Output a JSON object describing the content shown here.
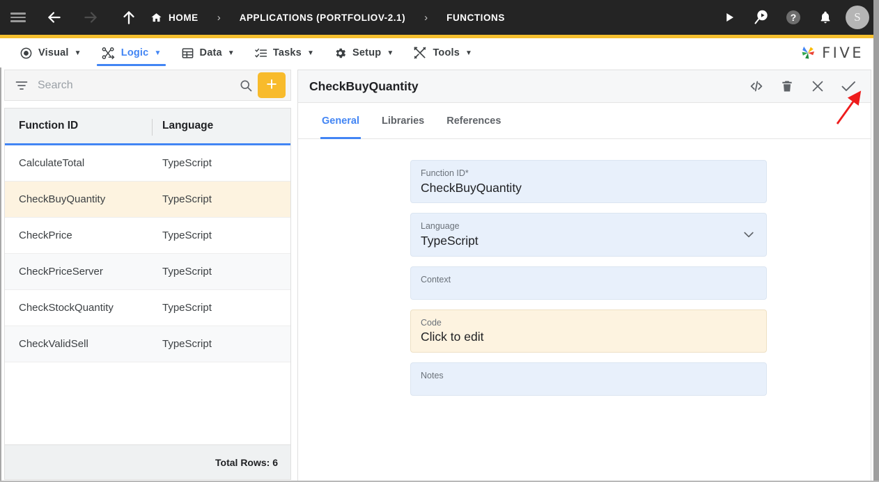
{
  "topbar": {
    "menu_icon": "hamburger-icon",
    "back_icon": "arrow-back-icon",
    "forward_icon": "arrow-forward-icon",
    "up_icon": "arrow-up-icon",
    "breadcrumbs": [
      {
        "label": "HOME",
        "icon": "home-icon"
      },
      {
        "label": "APPLICATIONS (PORTFOLIOV-2.1)",
        "icon": ""
      },
      {
        "label": "FUNCTIONS",
        "icon": ""
      }
    ],
    "separator": "›",
    "actions": [
      {
        "name": "run-button",
        "icon": "play-icon"
      },
      {
        "name": "search-run-button",
        "icon": "search-play-icon"
      },
      {
        "name": "help-button",
        "icon": "help-circle-icon"
      },
      {
        "name": "notifications-button",
        "icon": "bell-icon"
      }
    ],
    "avatar_initial": "S",
    "accent_color": "#f5bf2e",
    "background_color": "#242424"
  },
  "menubar": {
    "items": [
      {
        "label": "Visual",
        "icon": "eye-icon",
        "active": false
      },
      {
        "label": "Logic",
        "icon": "logic-network-icon",
        "active": true
      },
      {
        "label": "Data",
        "icon": "table-icon",
        "active": false
      },
      {
        "label": "Tasks",
        "icon": "checklist-icon",
        "active": false
      },
      {
        "label": "Setup",
        "icon": "gear-icon",
        "active": false
      },
      {
        "label": "Tools",
        "icon": "tools-icon",
        "active": false
      }
    ],
    "caret": "▼",
    "brand": "FIVE",
    "active_color": "#4285f4"
  },
  "sidebar": {
    "search": {
      "placeholder": "Search",
      "value": ""
    },
    "filter_icon": "filter-icon",
    "search_icon": "search-icon",
    "add_label": "+",
    "add_color": "#f8bb2c",
    "grid": {
      "columns": [
        "Function ID",
        "Language"
      ],
      "rows": [
        {
          "function_id": "CalculateTotal",
          "language": "TypeScript"
        },
        {
          "function_id": "CheckBuyQuantity",
          "language": "TypeScript"
        },
        {
          "function_id": "CheckPrice",
          "language": "TypeScript"
        },
        {
          "function_id": "CheckPriceServer",
          "language": "TypeScript"
        },
        {
          "function_id": "CheckStockQuantity",
          "language": "TypeScript"
        },
        {
          "function_id": "CheckValidSell",
          "language": "TypeScript"
        }
      ],
      "selected_index": 1,
      "footer": "Total Rows: 6",
      "selected_color": "#fdf3e0"
    }
  },
  "detail": {
    "title": "CheckBuyQuantity",
    "actions": [
      {
        "name": "view-code-button",
        "icon": "code-icon"
      },
      {
        "name": "delete-button",
        "icon": "trash-icon"
      },
      {
        "name": "close-button",
        "icon": "close-icon"
      },
      {
        "name": "save-button",
        "icon": "check-icon"
      }
    ],
    "tabs": [
      {
        "label": "General",
        "active": true
      },
      {
        "label": "Libraries",
        "active": false
      },
      {
        "label": "References",
        "active": false
      }
    ],
    "fields": [
      {
        "label": "Function ID",
        "required": true,
        "value": "CheckBuyQuantity",
        "type": "text"
      },
      {
        "label": "Language",
        "required": false,
        "value": "TypeScript",
        "type": "select",
        "chevron": "chevron-down-icon"
      },
      {
        "label": "Context",
        "required": false,
        "value": "",
        "type": "text"
      },
      {
        "label": "Code",
        "required": false,
        "value": "Click to edit",
        "type": "code"
      },
      {
        "label": "Notes",
        "required": false,
        "value": "",
        "type": "text"
      }
    ],
    "required_marker": "*",
    "annotation": {
      "name": "red-arrow-annotation",
      "points_to": "save-button",
      "color": "#ee1c1c"
    }
  }
}
